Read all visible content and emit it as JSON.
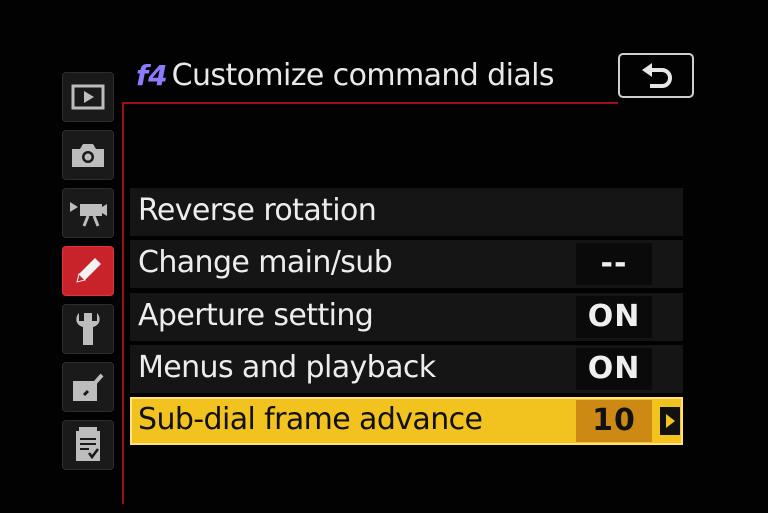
{
  "header": {
    "code": "f4",
    "title": "Customize command dials"
  },
  "rail": {
    "items": [
      {
        "icon": "playback-icon",
        "active": false
      },
      {
        "icon": "camera-icon",
        "active": false
      },
      {
        "icon": "movie-icon",
        "active": false
      },
      {
        "icon": "pencil-icon",
        "active": true
      },
      {
        "icon": "wrench-icon",
        "active": false
      },
      {
        "icon": "retouch-icon",
        "active": false
      },
      {
        "icon": "recent-settings-icon",
        "active": false
      }
    ]
  },
  "back_button": {
    "icon": "back-arrow-icon"
  },
  "menu": {
    "items": [
      {
        "label": "Reverse rotation",
        "value": ""
      },
      {
        "label": "Change main/sub",
        "value": "--"
      },
      {
        "label": "Aperture setting",
        "value": "ON"
      },
      {
        "label": "Menus and playback",
        "value": "ON"
      },
      {
        "label": "Sub-dial frame advance",
        "value": "10",
        "selected": true
      }
    ]
  },
  "colors": {
    "accent_red": "#c8232b",
    "highlight_yellow": "#f2c31f",
    "value_orange": "#cc8a14",
    "code_purple": "#8a7bff"
  }
}
